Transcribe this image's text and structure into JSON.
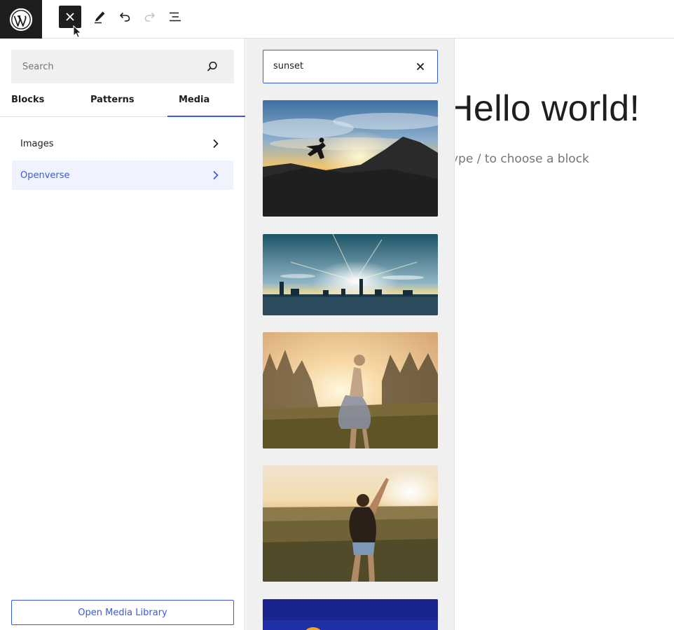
{
  "toolbar": {
    "close_label": "Close block inserter",
    "tools_label": "Tools",
    "undo_label": "Undo",
    "redo_label": "Redo",
    "outline_label": "Document overview"
  },
  "inserter": {
    "search_placeholder": "Search",
    "tabs": [
      {
        "label": "Blocks"
      },
      {
        "label": "Patterns"
      },
      {
        "label": "Media"
      }
    ],
    "media_categories": [
      {
        "label": "Images"
      },
      {
        "label": "Openverse"
      }
    ],
    "open_library_label": "Open Media Library"
  },
  "openverse": {
    "search_value": "sunset",
    "results": [
      {
        "icon": "jumping-silhouette-sunset-image"
      },
      {
        "icon": "people-silhouettes-sun-flare-image"
      },
      {
        "icon": "girl-spinning-backlit-field-image"
      },
      {
        "icon": "woman-raising-arm-wheat-field-image"
      },
      {
        "icon": "sunflower-blue-sky-image"
      }
    ]
  },
  "canvas": {
    "post_title": "Hello world!",
    "block_placeholder": "ype / to choose a block"
  },
  "colors": {
    "accent": "#3858e9",
    "toolbar_dark": "#1e1e1e",
    "panel_bg": "#f0f0f0"
  }
}
